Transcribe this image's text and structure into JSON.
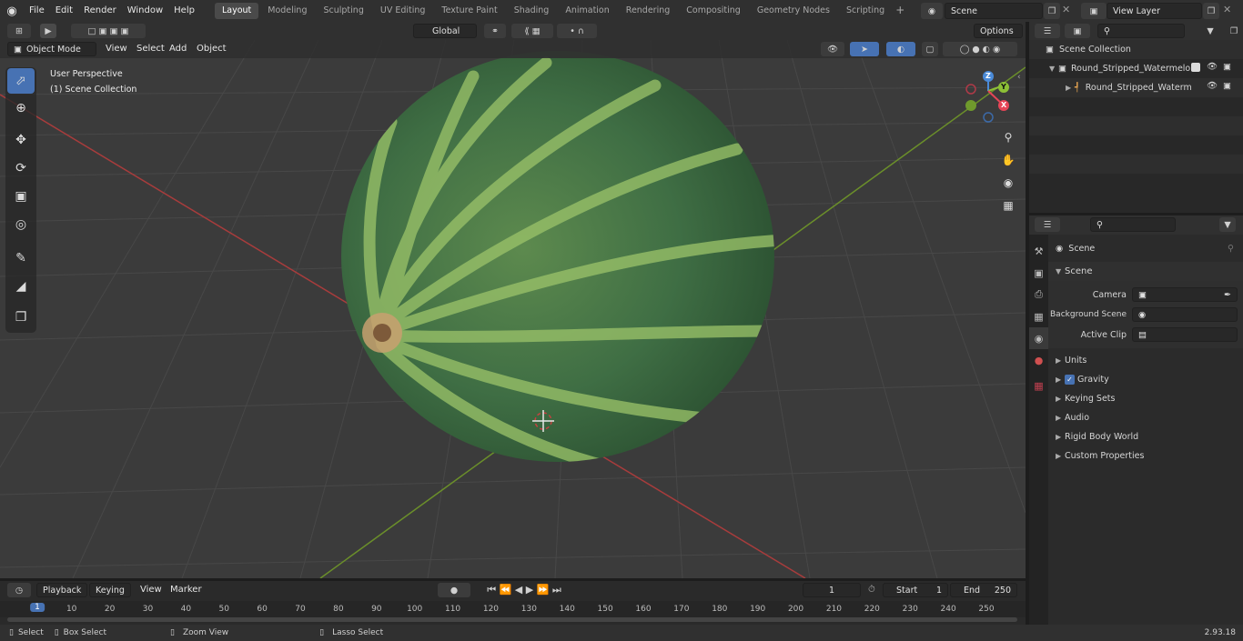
{
  "menu": {
    "file": "File",
    "edit": "Edit",
    "render": "Render",
    "window": "Window",
    "help": "Help"
  },
  "workspaces": [
    "Layout",
    "Modeling",
    "Sculpting",
    "UV Editing",
    "Texture Paint",
    "Shading",
    "Animation",
    "Rendering",
    "Compositing",
    "Geometry Nodes",
    "Scripting"
  ],
  "scene_name": "Scene",
  "view_layer": "View Layer",
  "viewport": {
    "mode": "Object Mode",
    "view": "View",
    "select": "Select",
    "add": "Add",
    "object": "Object",
    "orientation": "Global",
    "options": "Options",
    "perspective": "User Perspective",
    "collection": "(1) Scene Collection",
    "gizmo_z": "Z",
    "gizmo_y": "Y",
    "gizmo_x": "X"
  },
  "outliner": {
    "root": "Scene Collection",
    "items": [
      {
        "label": "Round_Stripped_Watermelon"
      },
      {
        "label": "Round_Stripped_Waterm"
      }
    ]
  },
  "properties": {
    "context": "Scene",
    "section": "Scene",
    "camera_label": "Camera",
    "background_label": "Background Scene",
    "clip_label": "Active Clip",
    "panels": [
      "Units",
      "Gravity",
      "Keying Sets",
      "Audio",
      "Rigid Body World",
      "Custom Properties"
    ],
    "gravity_checked": true
  },
  "timeline": {
    "playback": "Playback",
    "keying": "Keying",
    "view": "View",
    "marker": "Marker",
    "current_frame": "1",
    "start_label": "Start",
    "start_value": "1",
    "end_label": "End",
    "end_value": "250",
    "ticks": [
      "1",
      "10",
      "20",
      "30",
      "40",
      "50",
      "60",
      "70",
      "80",
      "90",
      "100",
      "110",
      "120",
      "130",
      "140",
      "150",
      "160",
      "170",
      "180",
      "190",
      "200",
      "210",
      "220",
      "230",
      "240",
      "250"
    ]
  },
  "status": {
    "select": "Select",
    "box_select": "Box Select",
    "zoom_view": "Zoom View",
    "lasso_select": "Lasso Select",
    "version": "2.93.18"
  },
  "colors": {
    "accent": "#4772b3",
    "x_axis": "#b03a3a",
    "y_axis": "#6f9a2c",
    "gizmo_x": "#e64557",
    "gizmo_y": "#8cc036",
    "gizmo_z": "#4a8ad8"
  }
}
